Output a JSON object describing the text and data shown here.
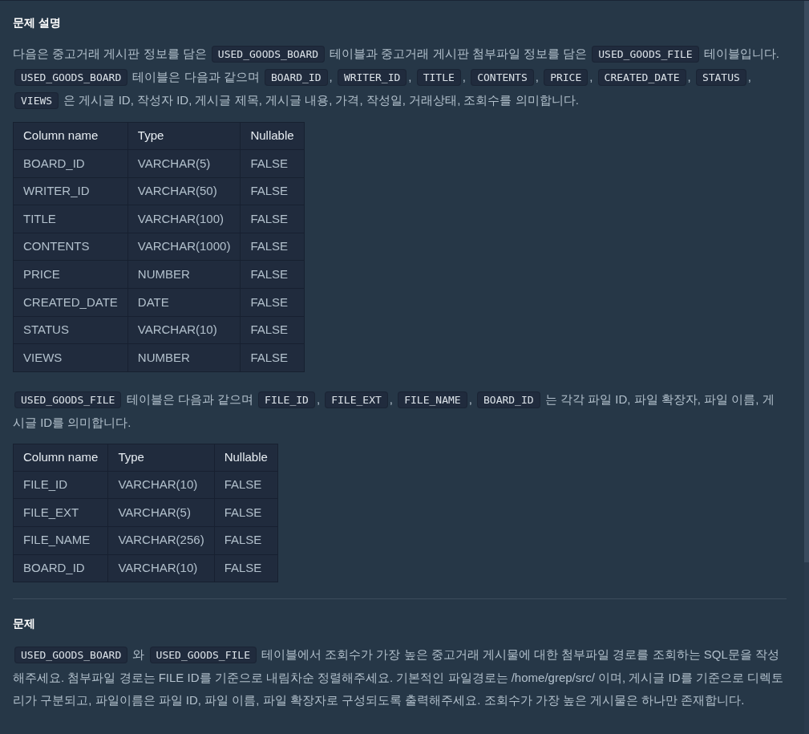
{
  "sections": [
    {
      "heading": "문제 설명",
      "blocks": [
        {
          "kind": "paragraph",
          "segments": [
            {
              "kind": "text",
              "text": "다음은 중고거래 게시판 정보를 담은 "
            },
            {
              "kind": "code",
              "text": "USED_GOODS_BOARD"
            },
            {
              "kind": "text",
              "text": " 테이블과 중고거래 게시판 첨부파일 정보를 담은 "
            },
            {
              "kind": "code",
              "text": "USED_GOODS_FILE"
            },
            {
              "kind": "text",
              "text": " 테이블입니다. "
            },
            {
              "kind": "code",
              "text": "USED_GOODS_BOARD"
            },
            {
              "kind": "text",
              "text": " 테이블은 다음과 같으며 "
            },
            {
              "kind": "code",
              "text": "BOARD_ID"
            },
            {
              "kind": "text",
              "text": ", "
            },
            {
              "kind": "code",
              "text": "WRITER_ID"
            },
            {
              "kind": "text",
              "text": ", "
            },
            {
              "kind": "code",
              "text": "TITLE"
            },
            {
              "kind": "text",
              "text": ", "
            },
            {
              "kind": "code",
              "text": "CONTENTS"
            },
            {
              "kind": "text",
              "text": ", "
            },
            {
              "kind": "code",
              "text": "PRICE"
            },
            {
              "kind": "text",
              "text": ", "
            },
            {
              "kind": "code",
              "text": "CREATED_DATE"
            },
            {
              "kind": "text",
              "text": ", "
            },
            {
              "kind": "code",
              "text": "STATUS"
            },
            {
              "kind": "text",
              "text": ", "
            },
            {
              "kind": "code",
              "text": "VIEWS"
            },
            {
              "kind": "text",
              "text": " 은 게시글 ID, 작성자 ID, 게시글 제목, 게시글 내용, 가격, 작성일, 거래상태, 조회수를 의미합니다."
            }
          ]
        },
        {
          "kind": "table",
          "columns": [
            "Column name",
            "Type",
            "Nullable"
          ],
          "rows": [
            [
              "BOARD_ID",
              "VARCHAR(5)",
              "FALSE"
            ],
            [
              "WRITER_ID",
              "VARCHAR(50)",
              "FALSE"
            ],
            [
              "TITLE",
              "VARCHAR(100)",
              "FALSE"
            ],
            [
              "CONTENTS",
              "VARCHAR(1000)",
              "FALSE"
            ],
            [
              "PRICE",
              "NUMBER",
              "FALSE"
            ],
            [
              "CREATED_DATE",
              "DATE",
              "FALSE"
            ],
            [
              "STATUS",
              "VARCHAR(10)",
              "FALSE"
            ],
            [
              "VIEWS",
              "NUMBER",
              "FALSE"
            ]
          ]
        },
        {
          "kind": "paragraph",
          "segments": [
            {
              "kind": "code",
              "text": "USED_GOODS_FILE"
            },
            {
              "kind": "text",
              "text": " 테이블은 다음과 같으며 "
            },
            {
              "kind": "code",
              "text": "FILE_ID"
            },
            {
              "kind": "text",
              "text": ", "
            },
            {
              "kind": "code",
              "text": "FILE_EXT"
            },
            {
              "kind": "text",
              "text": ", "
            },
            {
              "kind": "code",
              "text": "FILE_NAME"
            },
            {
              "kind": "text",
              "text": ", "
            },
            {
              "kind": "code",
              "text": "BOARD_ID"
            },
            {
              "kind": "text",
              "text": " 는 각각 파일 ID, 파일 확장자, 파일 이름, 게시글 ID를 의미합니다."
            }
          ]
        },
        {
          "kind": "table",
          "columns": [
            "Column name",
            "Type",
            "Nullable"
          ],
          "rows": [
            [
              "FILE_ID",
              "VARCHAR(10)",
              "FALSE"
            ],
            [
              "FILE_EXT",
              "VARCHAR(5)",
              "FALSE"
            ],
            [
              "FILE_NAME",
              "VARCHAR(256)",
              "FALSE"
            ],
            [
              "BOARD_ID",
              "VARCHAR(10)",
              "FALSE"
            ]
          ]
        }
      ]
    },
    {
      "heading": "문제",
      "blocks": [
        {
          "kind": "paragraph",
          "segments": [
            {
              "kind": "code",
              "text": "USED_GOODS_BOARD"
            },
            {
              "kind": "text",
              "text": " 와 "
            },
            {
              "kind": "code",
              "text": "USED_GOODS_FILE"
            },
            {
              "kind": "text",
              "text": " 테이블에서 조회수가 가장 높은 중고거래 게시물에 대한 첨부파일 경로를 조회하는 SQL문을 작성해주세요. 첨부파일 경로는 FILE ID를 기준으로 내림차순 정렬해주세요. 기본적인 파일경로는 /home/grep/src/ 이며, 게시글 ID를 기준으로 디렉토리가 구분되고, 파일이름은 파일 ID, 파일 이름, 파일 확장자로 구성되도록 출력해주세요. 조회수가 가장 높은 게시물은 하나만 존재합니다."
            }
          ]
        }
      ]
    }
  ]
}
